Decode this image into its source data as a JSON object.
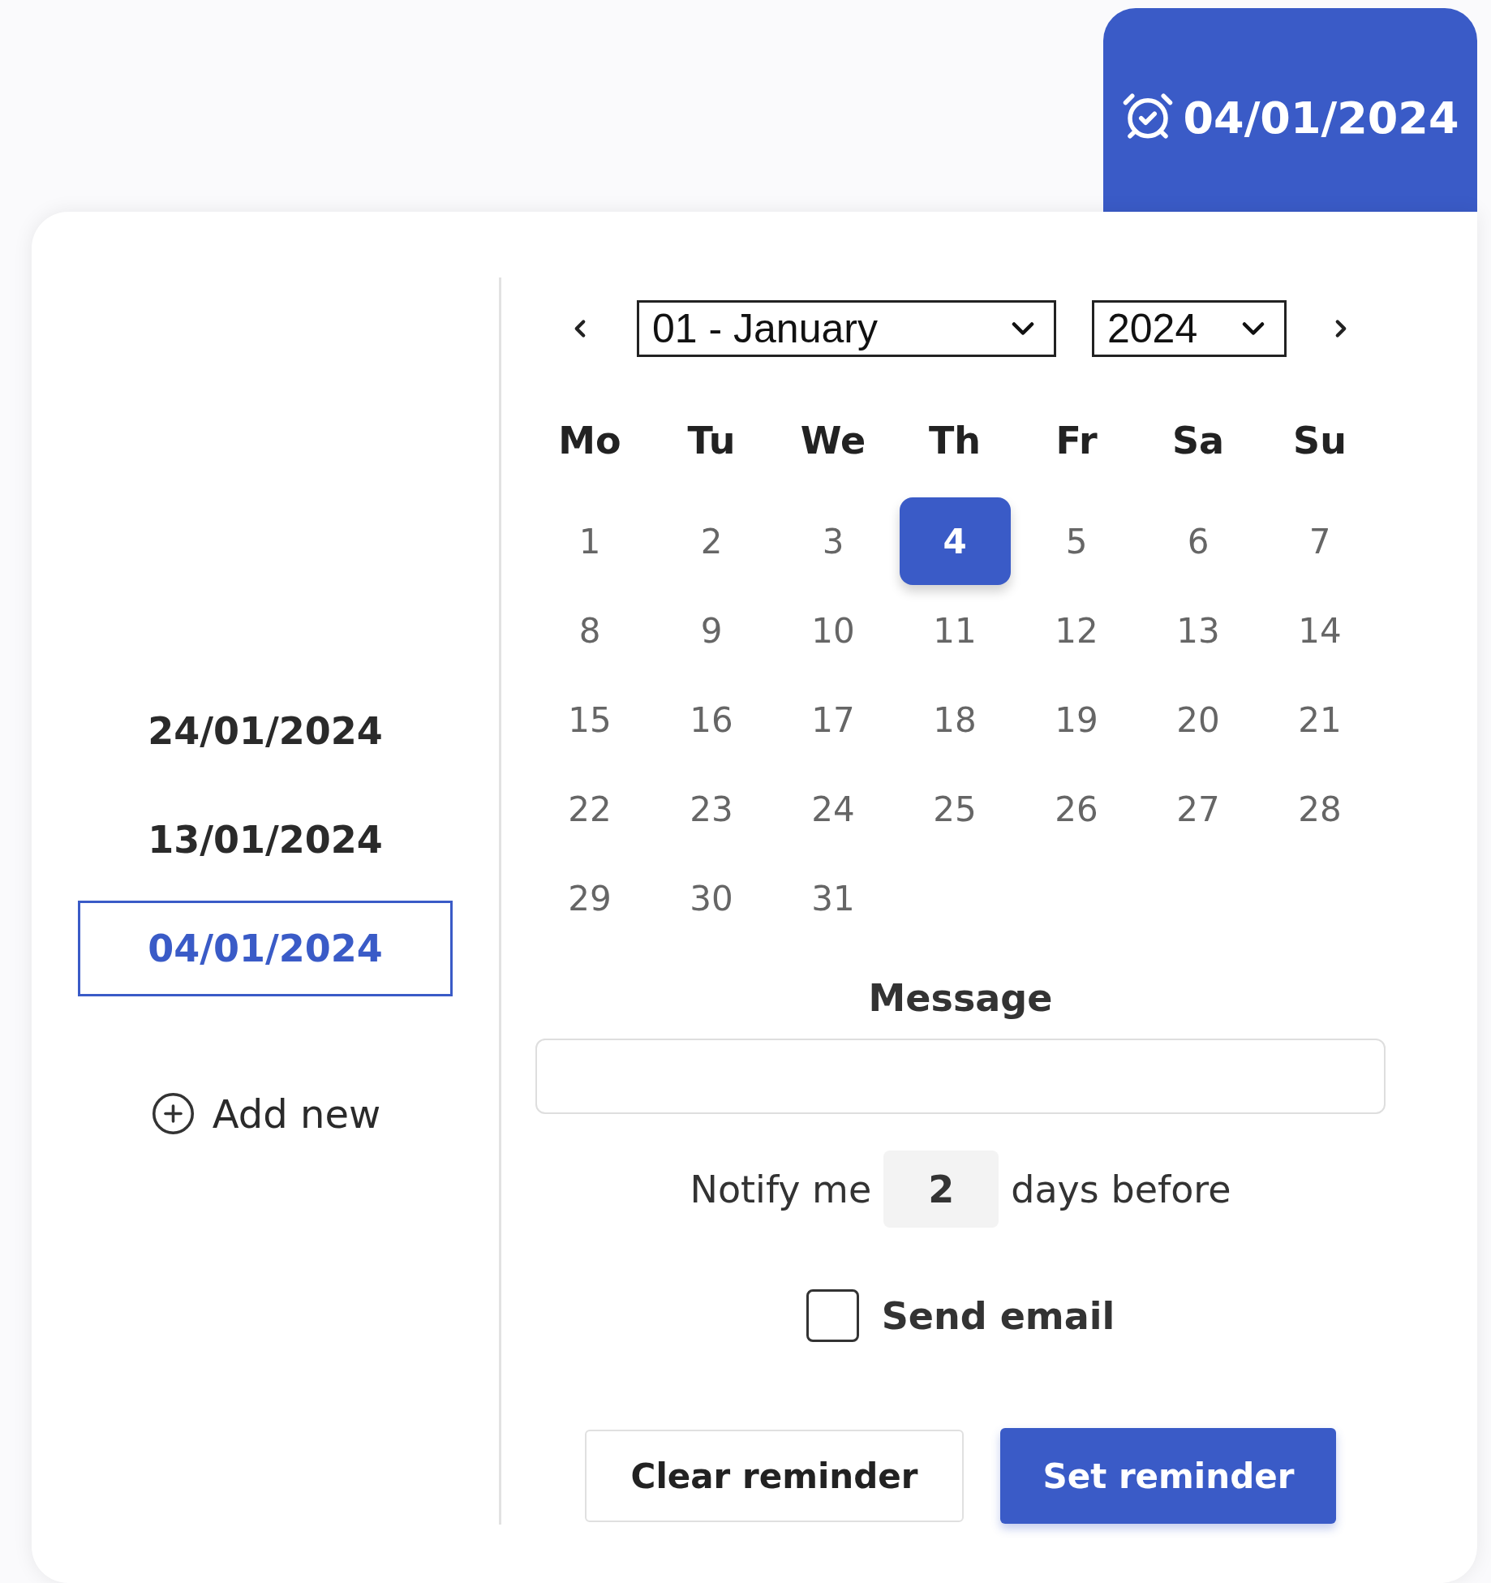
{
  "reminder_tab": {
    "date": "04/01/2024"
  },
  "saved_reminders": [
    {
      "date": "24/01/2024",
      "selected": false
    },
    {
      "date": "13/01/2024",
      "selected": false
    },
    {
      "date": "04/01/2024",
      "selected": true
    }
  ],
  "add_new": "Add new",
  "calendar": {
    "month": "01 - January",
    "year": "2024",
    "weekdays": [
      "Mo",
      "Tu",
      "We",
      "Th",
      "Fr",
      "Sa",
      "Su"
    ],
    "days": [
      {
        "label": "1",
        "selected": false
      },
      {
        "label": "2",
        "selected": false
      },
      {
        "label": "3",
        "selected": false
      },
      {
        "label": "4",
        "selected": true
      },
      {
        "label": "5",
        "selected": false
      },
      {
        "label": "6",
        "selected": false
      },
      {
        "label": "7",
        "selected": false
      },
      {
        "label": "8",
        "selected": false
      },
      {
        "label": "9",
        "selected": false
      },
      {
        "label": "10",
        "selected": false
      },
      {
        "label": "11",
        "selected": false
      },
      {
        "label": "12",
        "selected": false
      },
      {
        "label": "13",
        "selected": false
      },
      {
        "label": "14",
        "selected": false
      },
      {
        "label": "15",
        "selected": false
      },
      {
        "label": "16",
        "selected": false
      },
      {
        "label": "17",
        "selected": false
      },
      {
        "label": "18",
        "selected": false
      },
      {
        "label": "19",
        "selected": false
      },
      {
        "label": "20",
        "selected": false
      },
      {
        "label": "21",
        "selected": false
      },
      {
        "label": "22",
        "selected": false
      },
      {
        "label": "23",
        "selected": false
      },
      {
        "label": "24",
        "selected": false
      },
      {
        "label": "25",
        "selected": false
      },
      {
        "label": "26",
        "selected": false
      },
      {
        "label": "27",
        "selected": false
      },
      {
        "label": "28",
        "selected": false
      },
      {
        "label": "29",
        "selected": false
      },
      {
        "label": "30",
        "selected": false
      },
      {
        "label": "31",
        "selected": false
      }
    ]
  },
  "message": {
    "label": "Message"
  },
  "notify": {
    "prefix": "Notify me",
    "value": "2",
    "suffix": "days before"
  },
  "send_email": {
    "label": "Send email",
    "checked": false
  },
  "buttons": [
    {
      "label": "Clear reminder",
      "kind": "secondary"
    },
    {
      "label": "Set reminder",
      "kind": "primary"
    }
  ]
}
